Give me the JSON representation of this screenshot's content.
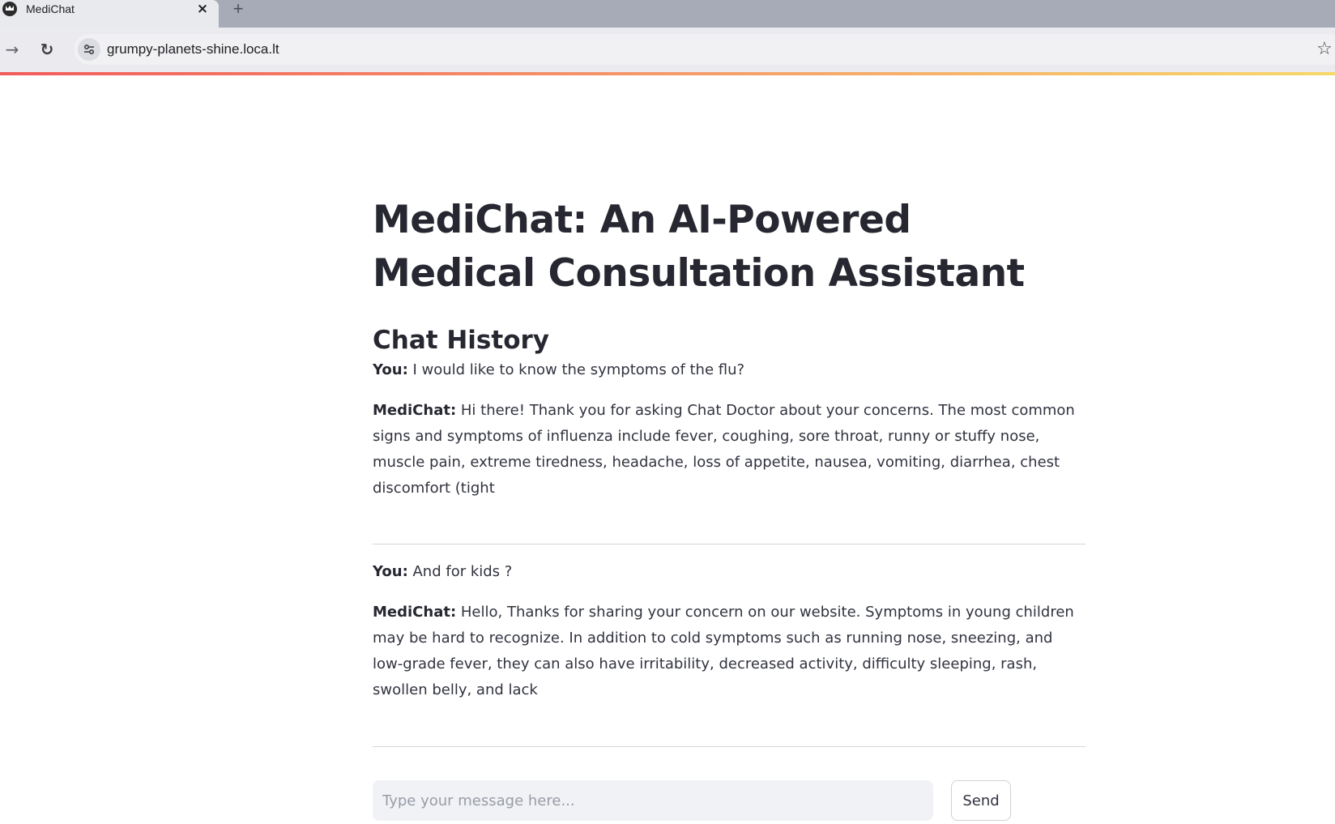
{
  "browser": {
    "tab": {
      "title": "MediChat",
      "favicon": "streamlit-crown-icon",
      "close_icon": "×"
    },
    "new_tab_icon": "+",
    "nav": {
      "forward_icon": "→",
      "reload_icon": "↻"
    },
    "address_bar": {
      "url": "grumpy-planets-shine.loca.lt",
      "site_info_icon": "tune-icon"
    },
    "bookmark_icon": "☆",
    "progress_colors": [
      "#f25c5c",
      "#f59a6a",
      "#f7d86b"
    ]
  },
  "page": {
    "title": "MediChat: An AI-Powered Medical Consultation Assistant",
    "section_heading": "Chat History",
    "messages": [
      {
        "speaker": "You:",
        "text": " I would like to know the symptoms of the flu?"
      },
      {
        "speaker": "MediChat:",
        "text": " Hi there! Thank you for asking Chat Doctor about your concerns. The most common signs and symptoms of influenza include fever, coughing, sore throat, runny or stuffy nose, muscle pain, extreme tiredness, headache, loss of appetite, nausea, vomiting, diarrhea, chest discomfort (tight"
      },
      {
        "speaker": "You:",
        "text": " And for kids ?"
      },
      {
        "speaker": "MediChat:",
        "text": " Hello, Thanks for sharing your concern on our website. Symptoms in young children may be hard to recognize. In addition to cold symptoms such as running nose, sneezing, and low-grade fever, they can also have irritability, decreased activity, difficulty sleeping, rash, swollen belly, and lack"
      }
    ],
    "input": {
      "placeholder": "Type your message here...",
      "value": ""
    },
    "send_label": "Send"
  }
}
